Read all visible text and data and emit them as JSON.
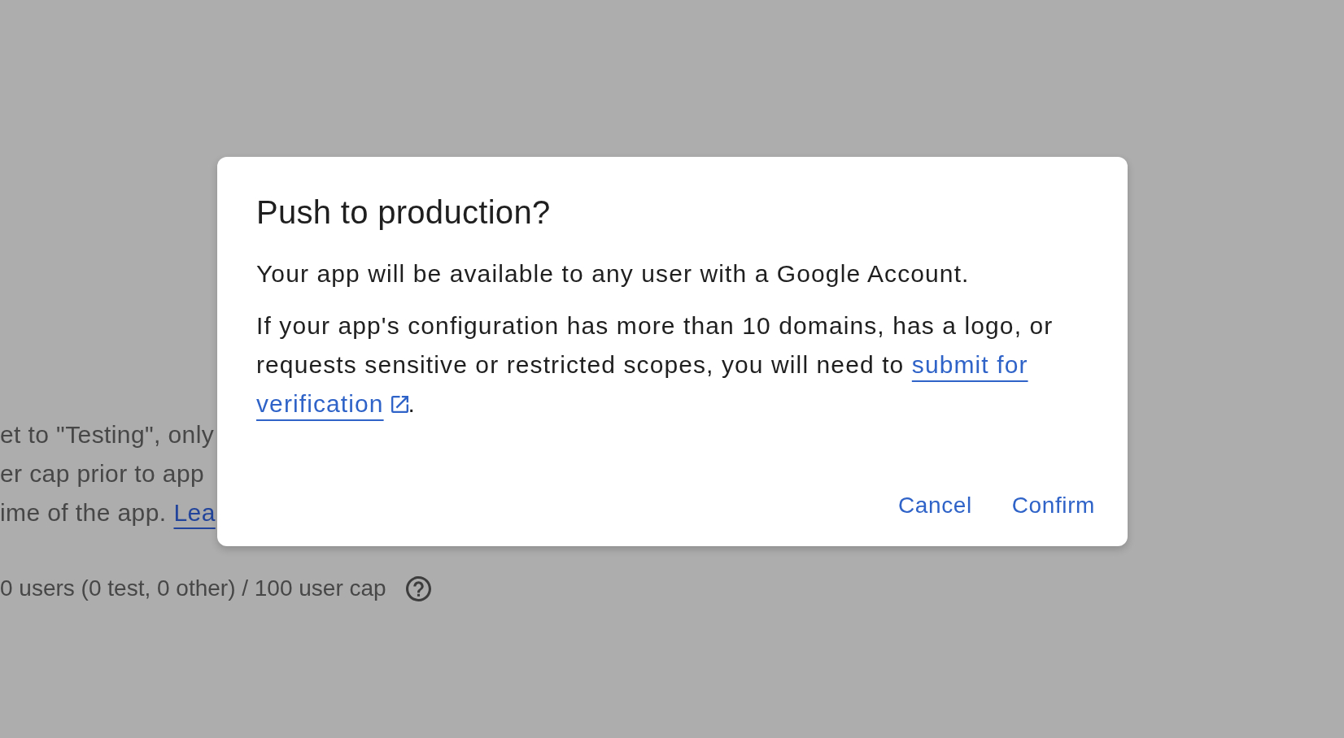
{
  "background": {
    "lines": [
      {
        "text": "et to \"Testing\", only"
      },
      {
        "text": "er cap prior to app"
      },
      {
        "text": "ime of the app.",
        "link": "Lea"
      }
    ],
    "user_count": "0 users (0 test, 0 other) / 100 user cap"
  },
  "dialog": {
    "title": "Push to production?",
    "paragraphs": [
      {
        "text": "Your app will be available to any user with a Google Account."
      },
      {
        "text": "If your app's configuration has more than 10 domains, has a logo, or requests sensitive or restricted scopes, you will need to",
        "link_parts": [
          "submit for",
          "verification"
        ],
        "after": "."
      }
    ],
    "buttons": [
      {
        "label": "Cancel"
      },
      {
        "label": "Confirm"
      }
    ]
  }
}
